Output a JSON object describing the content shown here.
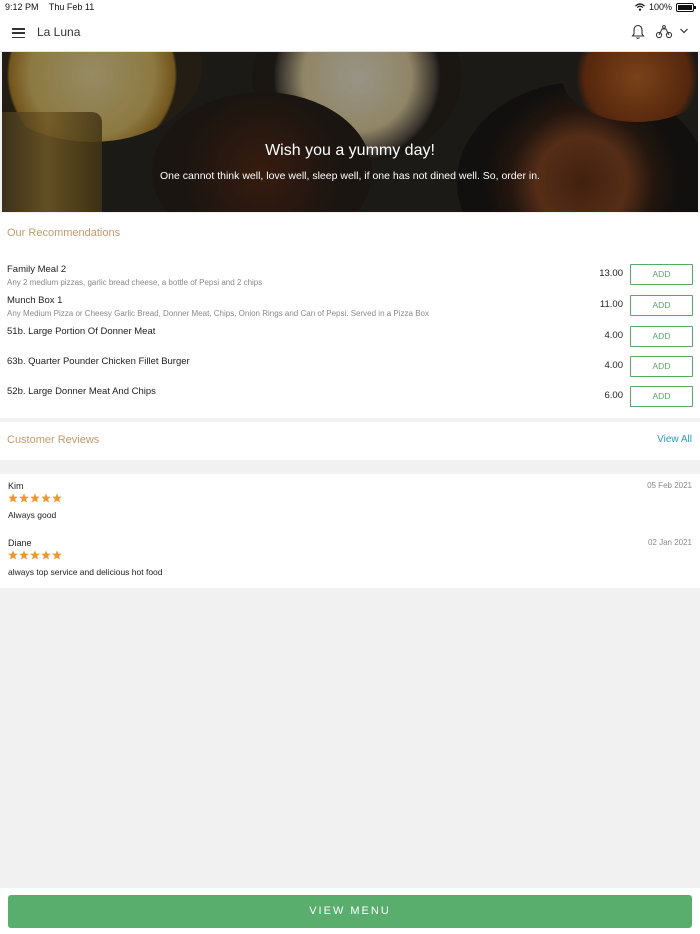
{
  "status_bar": {
    "time": "9:12 PM",
    "date": "Thu Feb 11",
    "battery": "100%"
  },
  "header": {
    "title": "La Luna"
  },
  "hero": {
    "title": "Wish you a yummy day!",
    "subtitle": "One cannot think well, love well, sleep well, if one has not dined well. So, order in."
  },
  "recommendations": {
    "heading": "Our Recommendations",
    "add_label": "ADD",
    "items": [
      {
        "name": "Family Meal 2",
        "description": "Any 2 medium pizzas, garlic bread cheese, a bottle of Pepsi and 2 chips",
        "price": "13.00"
      },
      {
        "name": "Munch Box 1",
        "description": "Any Medium Pizza or Cheesy Garlic Bread, Donner Meat, Chips, Onion Rings and Can of Pepsi. Served in a Pizza Box",
        "price": "11.00"
      },
      {
        "name": "51b. Large Portion Of Donner Meat",
        "description": "",
        "price": "4.00"
      },
      {
        "name": "63b. Quarter Pounder Chicken Fillet Burger",
        "description": "",
        "price": "4.00"
      },
      {
        "name": "52b. Large Donner Meat And Chips",
        "description": "",
        "price": "6.00"
      }
    ]
  },
  "reviews": {
    "heading": "Customer Reviews",
    "view_all": "View All",
    "items": [
      {
        "author": "Kim",
        "date": "05 Feb 2021",
        "rating": 5,
        "text": "Always good"
      },
      {
        "author": "Diane",
        "date": "02 Jan 2021",
        "rating": 5,
        "text": "always top service and delicious hot food"
      }
    ]
  },
  "footer": {
    "button_label": "VIEW MENU"
  },
  "colors": {
    "accent_green": "#5aae6d",
    "heading_tan": "#c39a6b",
    "link_blue": "#2a9ab7",
    "star_orange": "#f0962e"
  },
  "icons": [
    "menu-icon",
    "bell-icon",
    "delivery-scooter-icon",
    "chevron-down-icon",
    "wifi-icon",
    "battery-icon",
    "star-icon"
  ]
}
